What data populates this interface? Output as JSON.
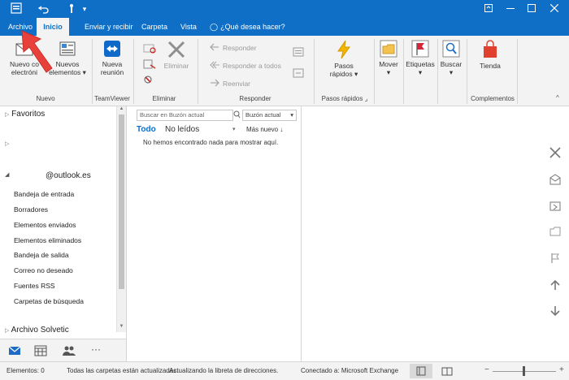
{
  "tabs": {
    "archivo": "Archivo",
    "inicio": "Inicio",
    "enviar": "Enviar y recibir",
    "carpeta": "Carpeta",
    "vista": "Vista",
    "tell_me": "¿Qué desea hacer?"
  },
  "ribbon": {
    "nuevo_correo": "Nuevo correo electrónico",
    "nuevo_correo_l1": "Nuevo co",
    "nuevo_correo_l2": "electróni",
    "nuevos_elementos_l1": "Nuevos",
    "nuevos_elementos_l2": "elementos",
    "group_nuevo": "Nuevo",
    "nueva_reunion_l1": "Nueva",
    "nueva_reunion_l2": "reunión",
    "group_teamviewer": "TeamViewer",
    "eliminar": "Eliminar",
    "group_eliminar": "Eliminar",
    "responder": "Responder",
    "responder_todos": "Responder a todos",
    "reenviar": "Reenviar",
    "group_responder": "Responder",
    "pasos_l1": "Pasos",
    "pasos_l2": "rápidos",
    "group_pasos": "Pasos rápidos",
    "mover": "Mover",
    "etiquetas": "Etiquetas",
    "buscar": "Buscar",
    "tienda": "Tienda",
    "group_complementos": "Complementos"
  },
  "nav": {
    "favoritos": "Favoritos",
    "account": "@outlook.es",
    "folders": [
      "Bandeja de entrada",
      "Borradores",
      "Elementos enviados",
      "Elementos eliminados",
      "Bandeja de salida",
      "Correo no deseado",
      "Fuentes RSS",
      "Carpetas de búsqueda"
    ],
    "archivo_solvetic": "Archivo Solvetic"
  },
  "list": {
    "search_placeholder": "Buscar en Buzón actual",
    "scope": "Buzón actual",
    "filter_all": "Todo",
    "filter_unread": "No leídos",
    "sort": "Más nuevo",
    "empty": "No hemos encontrado nada para mostrar aquí."
  },
  "status": {
    "elementos": "Elementos: 0",
    "updated": "Todas las carpetas están actualizadas.",
    "updating": "Actualizando la libreta de direcciones.",
    "connected": "Conectado a: Microsoft Exchange"
  },
  "colors": {
    "accent": "#0f6fc6",
    "arrow": "#e8403a"
  }
}
